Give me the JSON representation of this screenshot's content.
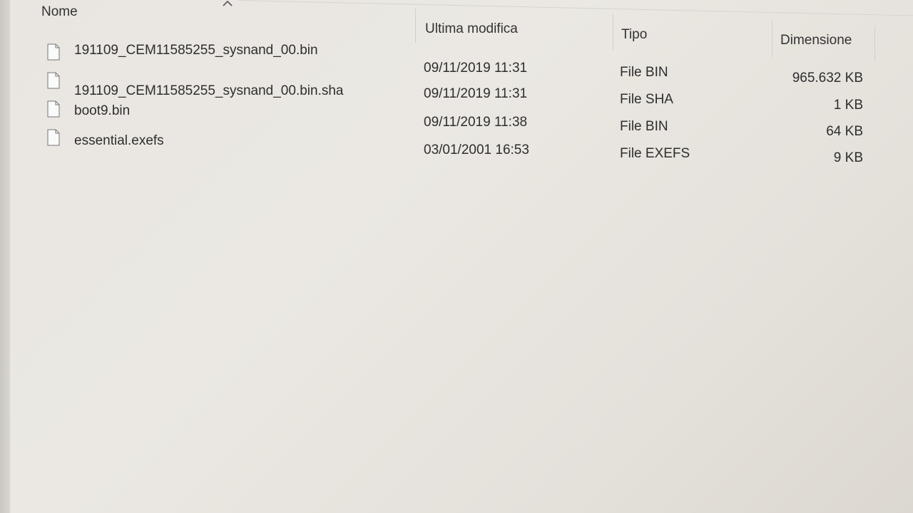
{
  "columns": {
    "name": "Nome",
    "modified": "Ultima modifica",
    "type": "Tipo",
    "size": "Dimensione"
  },
  "files": [
    {
      "name": "191109_CEM11585255_sysnand_00.bin",
      "modified": "09/11/2019 11:31",
      "type": "File BIN",
      "size": "965.632 KB",
      "icon": "file-icon"
    },
    {
      "name": "191109_CEM11585255_sysnand_00.bin.sha",
      "modified": "09/11/2019 11:31",
      "type": "File SHA",
      "size": "1 KB",
      "icon": "file-icon"
    },
    {
      "name": "boot9.bin",
      "modified": "09/11/2019 11:38",
      "type": "File BIN",
      "size": "64 KB",
      "icon": "file-icon"
    },
    {
      "name": "essential.exefs",
      "modified": "03/01/2001 16:53",
      "type": "File EXEFS",
      "size": "9 KB",
      "icon": "file-icon"
    }
  ]
}
